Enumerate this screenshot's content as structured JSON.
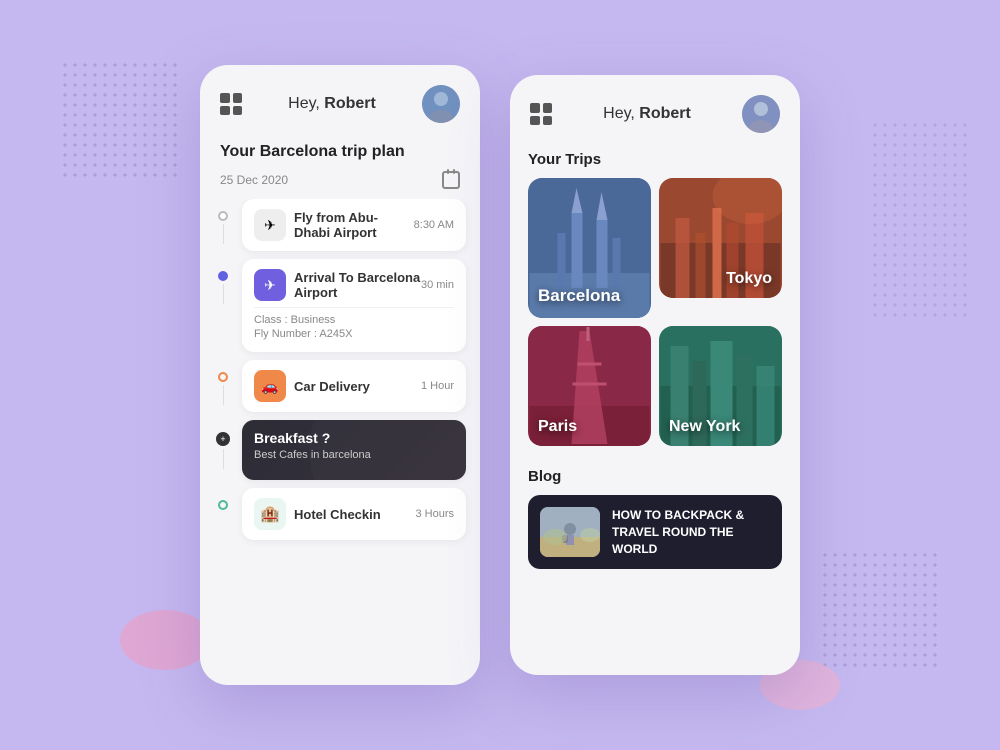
{
  "app": {
    "background_color": "#c5b8f0"
  },
  "left_phone": {
    "greeting": "Hey, ",
    "user_name": "Robert",
    "trip_title": "Your Barcelona trip plan",
    "date": "25 Dec 2020",
    "timeline_items": [
      {
        "id": "fly",
        "icon": "✈",
        "icon_style": "gray",
        "title": "Fly from Abu-Dhabi Airport",
        "time": "8:30 AM",
        "dot_style": "gray",
        "has_details": false
      },
      {
        "id": "arrival",
        "icon": "✈",
        "icon_style": "purple",
        "title": "Arrival To Barcelona Airport",
        "time": "30 min",
        "dot_style": "blue",
        "has_details": true,
        "class_label": "Class : Business",
        "fly_number": "Fly Number : A245X"
      },
      {
        "id": "car",
        "icon": "🚗",
        "icon_style": "orange",
        "title": "Car Delivery",
        "time": "1 Hour",
        "dot_style": "orange",
        "has_details": false
      },
      {
        "id": "breakfast",
        "icon": null,
        "title": "Breakfast ?",
        "subtitle": "Best Cafes in barcelona",
        "dot_style": "dark",
        "is_dark": true,
        "has_details": false
      },
      {
        "id": "hotel",
        "icon": "🏨",
        "icon_style": "green",
        "title": "Hotel Checkin",
        "time": "3 Hours",
        "dot_style": "green",
        "has_details": false
      }
    ]
  },
  "right_phone": {
    "greeting": "Hey, ",
    "user_name": "Robert",
    "trips_section_title": "Your Trips",
    "trips": [
      {
        "id": "barcelona",
        "label": "Barcelona",
        "color_class": "bg-barcelona",
        "grid_col": 1,
        "grid_row": "span 2"
      },
      {
        "id": "tokyo",
        "label": "Tokyo",
        "color_class": "bg-tokyo"
      },
      {
        "id": "paris",
        "label": "Paris",
        "color_class": "bg-paris"
      },
      {
        "id": "newyork",
        "label": "New York",
        "color_class": "bg-newyork"
      }
    ],
    "blog_section_title": "Blog",
    "blog_items": [
      {
        "id": "backpack",
        "title": "HOW TO BACKPACK & TRAVEL ROUND THE WORLD"
      }
    ]
  }
}
